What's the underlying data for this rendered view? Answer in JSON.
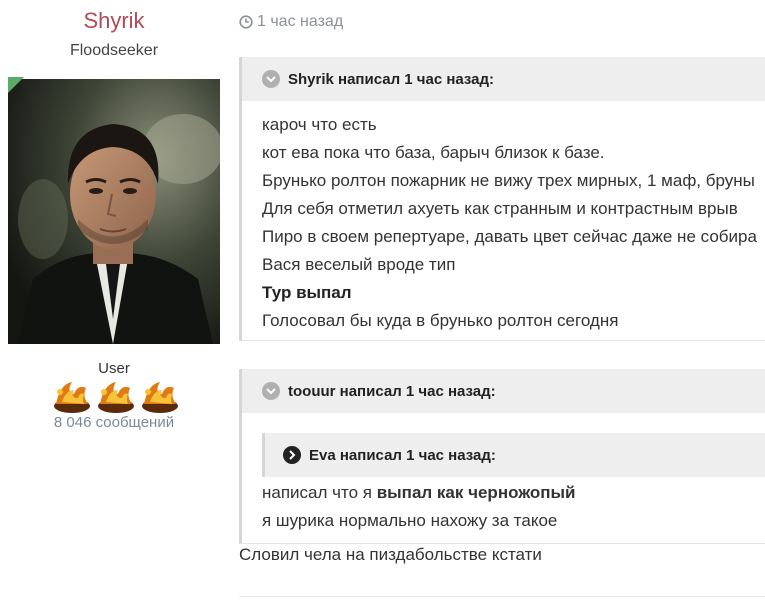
{
  "author": {
    "name": "Shyrik",
    "title": "Floodseeker",
    "role": "User",
    "messages": "8 046 сообщений",
    "status_color": "#5aab67",
    "name_color": "#b34a55"
  },
  "post": {
    "date": "1 час назад",
    "date_icon": "clock-icon",
    "quote1": {
      "header": "Shyrik написал 1 час назад:",
      "lines": [
        "кароч что есть",
        "кот ева пока что база, барыч близок к базе.",
        "Брунько ролтон пожарник не вижу трех мирных, 1 маф, бруны",
        "Для себя отметил ахуеть как странным и контрастным врыв",
        "Пиро в своем репертуаре, давать цвет сейчас даже не собира",
        "Вася веселый вроде тип",
        "Тур выпал",
        "Голосовал бы куда в брунько ролтон сегодня"
      ]
    },
    "quote2": {
      "header": "toouur написал 1 час назад:",
      "nested_header": "Eva написал 1 час назад:",
      "line1_prefix": "написал что я ",
      "line1_bold": "выпал как черножопый",
      "line2": "я шурика нормально нахожу за такое"
    },
    "reply": "Словил чела на пиздабольстве кстати"
  }
}
